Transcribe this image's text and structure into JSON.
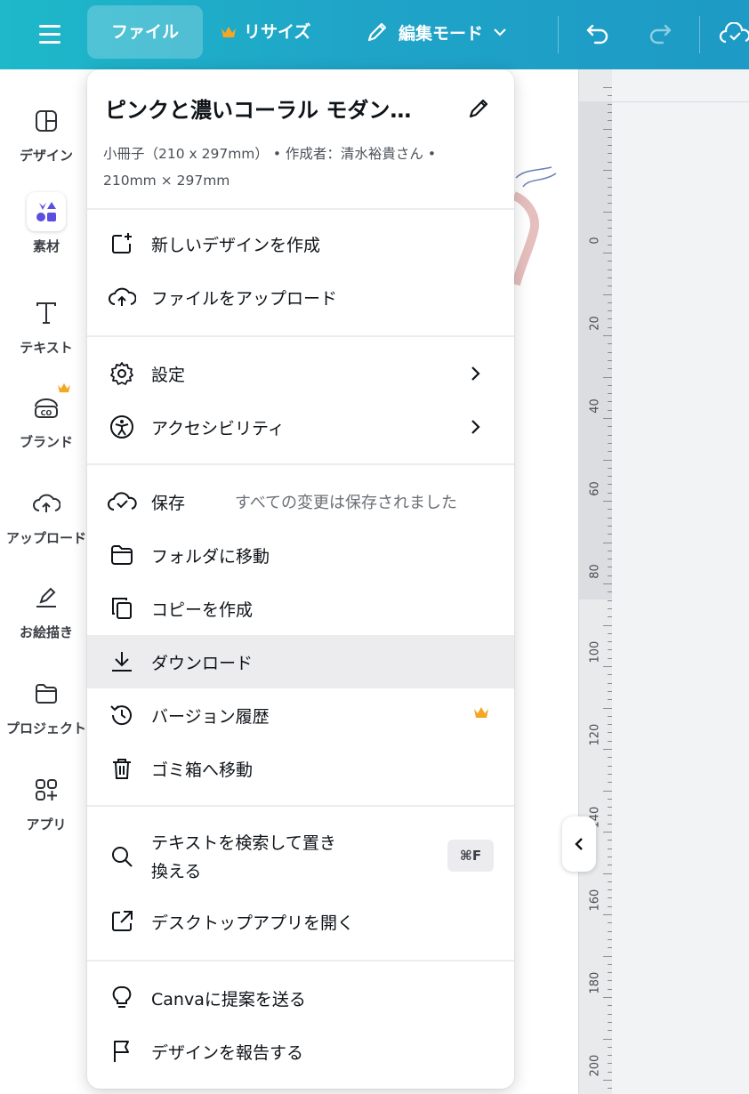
{
  "topbar": {
    "file_label": "ファイル",
    "resize_label": "リサイズ",
    "edit_mode_label": "編集モード",
    "brand_gradient": [
      "#1eb8c9",
      "#1d9ac5"
    ],
    "crown_color": "#f5a623"
  },
  "sidebar": {
    "items": [
      {
        "label": "デザイン",
        "icon": "layout-icon"
      },
      {
        "label": "素材",
        "icon": "elements-icon",
        "active": true
      },
      {
        "label": "テキスト",
        "icon": "text-icon"
      },
      {
        "label": "ブランド",
        "icon": "brand-icon",
        "premium": true
      },
      {
        "label": "アップロード",
        "icon": "upload-cloud-icon"
      },
      {
        "label": "お絵描き",
        "icon": "draw-icon"
      },
      {
        "label": "プロジェクト",
        "icon": "folder-icon"
      },
      {
        "label": "アプリ",
        "icon": "apps-icon"
      }
    ]
  },
  "menu": {
    "title": "ピンクと濃いコーラル モダン…",
    "meta_line1": "小冊子（210 x 297mm） • 作成者：清水裕貴さん •",
    "meta_line2": "210mm × 297mm",
    "groups": [
      [
        {
          "label": "新しいデザインを作成",
          "icon": "new-design-icon"
        },
        {
          "label": "ファイルをアップロード",
          "icon": "upload-cloud-icon"
        }
      ],
      [
        {
          "label": "設定",
          "icon": "settings-gear-icon",
          "submenu": true
        },
        {
          "label": "アクセシビリティ",
          "icon": "accessibility-icon",
          "submenu": true
        }
      ],
      [
        {
          "label": "保存",
          "icon": "save-check-cloud-icon",
          "status": "すべての変更は保存されました"
        },
        {
          "label": "フォルダに移動",
          "icon": "folder-icon"
        },
        {
          "label": "コピーを作成",
          "icon": "copy-icon"
        },
        {
          "label": "ダウンロード",
          "icon": "download-icon",
          "highlighted": true
        },
        {
          "label": "バージョン履歴",
          "icon": "history-icon",
          "premium": true
        },
        {
          "label": "ゴミ箱へ移動",
          "icon": "trash-icon"
        }
      ],
      [
        {
          "label_line1": "テキストを検索して置き",
          "label_line2": "換える",
          "icon": "search-icon",
          "shortcut": "⌘F"
        },
        {
          "label": "デスクトップアプリを開く",
          "icon": "external-link-icon"
        }
      ],
      [
        {
          "label": "Canvaに提案を送る",
          "icon": "lightbulb-icon"
        },
        {
          "label": "デザインを報告する",
          "icon": "flag-icon"
        }
      ]
    ]
  },
  "ruler": {
    "labels": [
      "0",
      "20",
      "40",
      "60",
      "80",
      "100",
      "120",
      "140",
      "160",
      "180",
      "200"
    ]
  }
}
